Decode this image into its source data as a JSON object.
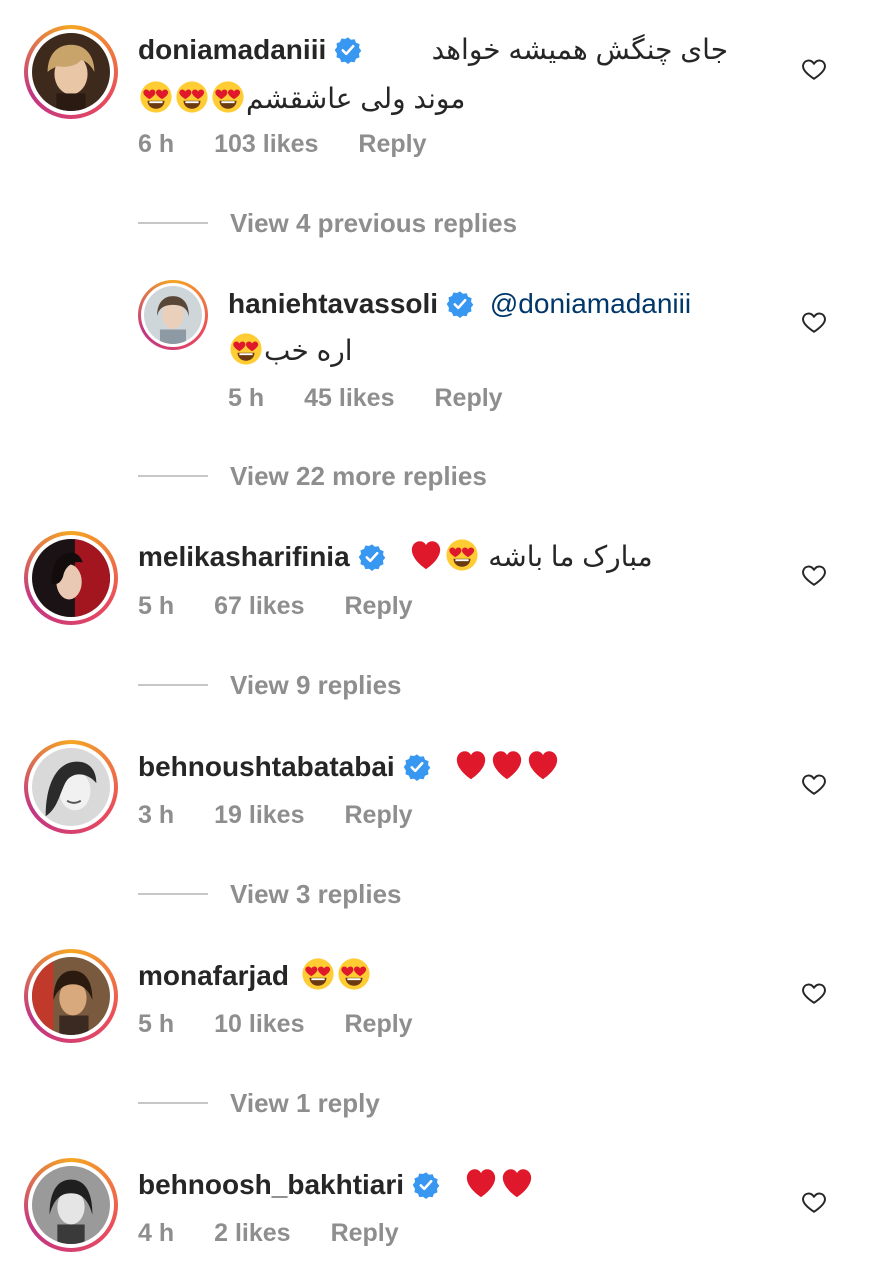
{
  "comments": [
    {
      "username": "doniamadaniii",
      "text_line1": "جای چنگش همیشه خواهد",
      "text_line2": "موند ولی عاشقشم",
      "time": "6 h",
      "likes": "103 likes",
      "reply": "Reply",
      "view_replies": "View 4 previous replies"
    },
    {
      "username": "haniehtavassoli",
      "mention": "@doniamadaniii",
      "text_line2": "اره خب",
      "time": "5 h",
      "likes": "45 likes",
      "reply": "Reply",
      "view_replies": "View 22 more replies"
    },
    {
      "username": "melikasharifinia",
      "text": "مبارک ما باشه",
      "time": "5 h",
      "likes": "67 likes",
      "reply": "Reply",
      "view_replies": "View 9 replies"
    },
    {
      "username": "behnoushtabatabai",
      "time": "3 h",
      "likes": "19 likes",
      "reply": "Reply",
      "view_replies": "View 3 replies"
    },
    {
      "username": "monafarjad",
      "time": "5 h",
      "likes": "10 likes",
      "reply": "Reply",
      "view_replies": "View 1 reply"
    },
    {
      "username": "behnoosh_bakhtiari",
      "time": "4 h",
      "likes": "2 likes",
      "reply": "Reply"
    }
  ],
  "colors": {
    "verified": "#3897f0",
    "meta": "#8e8e8e",
    "mention": "#00376b",
    "heart_emoji": "#e0182b"
  }
}
